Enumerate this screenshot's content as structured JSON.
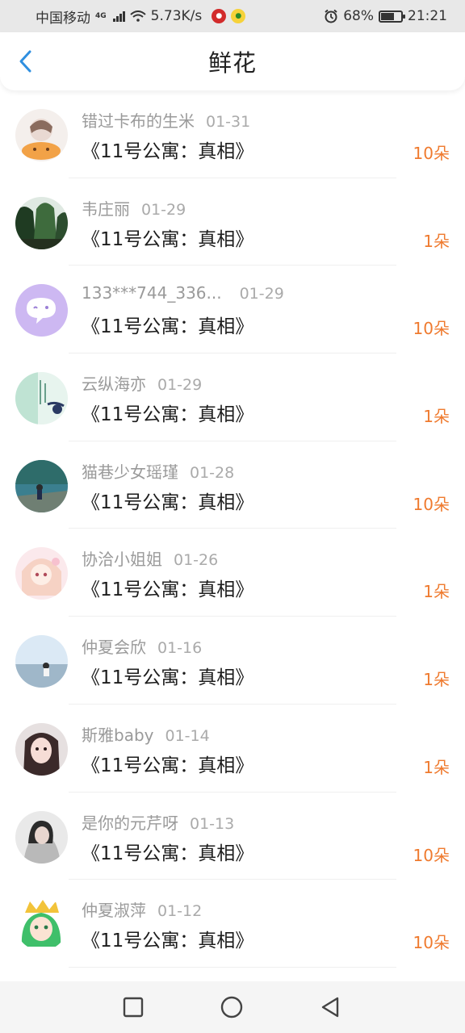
{
  "status_bar": {
    "carrier": "中国移动",
    "network_tag": "4G",
    "speed": "5.73K/s",
    "battery": "68%",
    "battery_level": 0.68,
    "time": "21:21",
    "icons": [
      "signal-icon",
      "wifi-icon",
      "app-notification-icon",
      "alarm-icon",
      "battery-icon"
    ]
  },
  "header": {
    "title": "鲜花",
    "back_icon": "chevron-left-icon",
    "accent_color": "#2f8fe0"
  },
  "list": {
    "count_color": "#ef7a2e",
    "items": [
      {
        "name": "错过卡布的生米",
        "date": "01-31",
        "book": "《11号公寓：真相》",
        "count": "10朵"
      },
      {
        "name": "韦庄丽",
        "date": "01-29",
        "book": "《11号公寓：真相》",
        "count": "1朵"
      },
      {
        "name": "133***744_336...",
        "date": "01-29",
        "book": "《11号公寓：真相》",
        "count": "10朵"
      },
      {
        "name": "云纵海亦",
        "date": "01-29",
        "book": "《11号公寓：真相》",
        "count": "1朵"
      },
      {
        "name": "猫巷少女瑶瑾",
        "date": "01-28",
        "book": "《11号公寓：真相》",
        "count": "10朵"
      },
      {
        "name": "协洽小姐姐",
        "date": "01-26",
        "book": "《11号公寓：真相》",
        "count": "1朵"
      },
      {
        "name": "仲夏会欣",
        "date": "01-16",
        "book": "《11号公寓：真相》",
        "count": "1朵"
      },
      {
        "name": "斯雅baby",
        "date": "01-14",
        "book": "《11号公寓：真相》",
        "count": "1朵"
      },
      {
        "name": "是你的元芹呀",
        "date": "01-13",
        "book": "《11号公寓：真相》",
        "count": "10朵"
      },
      {
        "name": "仲夏淑萍",
        "date": "01-12",
        "book": "《11号公寓：真相》",
        "count": "10朵"
      }
    ]
  },
  "nav_bar": {
    "icons": [
      "recent-apps-icon",
      "home-icon",
      "back-triangle-icon"
    ]
  }
}
